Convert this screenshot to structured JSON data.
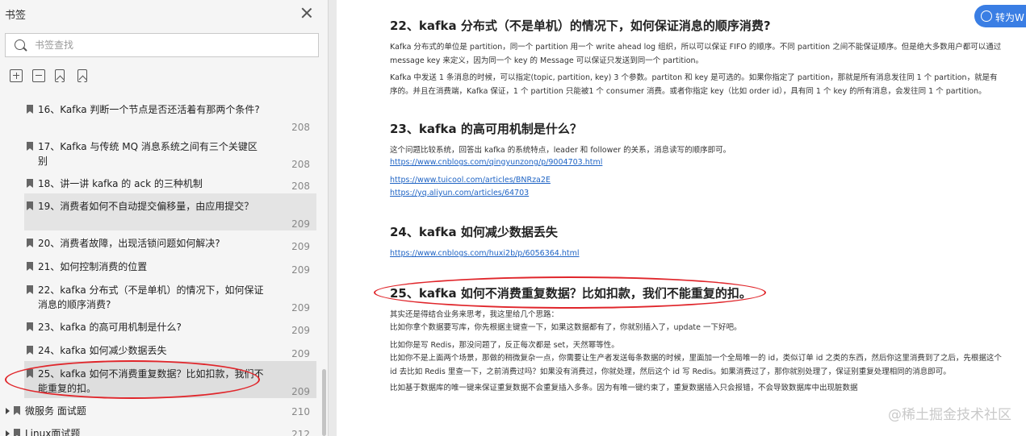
{
  "sidebar": {
    "title": "书签",
    "search_placeholder": "书签查找",
    "items": [
      {
        "text": "16、Kafka 判断一个节点是否还活着有那两个条件?",
        "page": "208"
      },
      {
        "text": "17、Kafka 与传统 MQ 消息系统之间有三个关键区别",
        "page": "208"
      },
      {
        "text": "18、讲一讲 kafka 的 ack 的三种机制",
        "page": "208"
      },
      {
        "text": "19、消费者如何不自动提交偏移量，由应用提交？",
        "page": "209"
      },
      {
        "text": "20、消费者故障，出现活锁问题如何解决?",
        "page": "209"
      },
      {
        "text": "21、如何控制消费的位置",
        "page": "209"
      },
      {
        "text": "22、kafka 分布式（不是单机）的情况下，如何保证消息的顺序消费?",
        "page": "209"
      },
      {
        "text": "23、kafka 的高可用机制是什么?",
        "page": "209"
      },
      {
        "text": "24、kafka 如何减少数据丢失",
        "page": "209"
      },
      {
        "text": "25、kafka 如何不消费重复数据？比如扣款，我们不能重复的扣。",
        "page": "209"
      }
    ],
    "groups": [
      {
        "text": "微服务 面试题",
        "page": "210"
      },
      {
        "text": "Linux面试题",
        "page": "212"
      }
    ]
  },
  "doc": {
    "convert_label": "转为W",
    "sections": [
      {
        "heading": "22、kafka 分布式（不是单机）的情况下，如何保证消息的顺序消费?",
        "paragraphs": [
          "Kafka 分布式的单位是 partition，同一个 partition 用一个 write ahead log 组织，所以可以保证 FIFO 的顺序。不同 partition 之间不能保证顺序。但是绝大多数用户都可以通过 message key 来定义，因为同一个 key 的 Message 可以保证只发送到同一个 partition。",
          "Kafka 中发送 1 条消息的时候，可以指定(topic, partition, key) 3 个参数。partiton 和 key 是可选的。如果你指定了 partition，那就是所有消息发往同 1 个 partition，就是有序的。并且在消费端，Kafka 保证，1 个 partition 只能被1 个 consumer 消费。或者你指定 key（比如 order id），具有同 1 个 key 的所有消息，会发往同 1 个 partition。"
        ]
      },
      {
        "heading": "23、kafka 的高可用机制是什么？",
        "paragraphs": [
          "这个问题比较系统，回答出 kafka 的系统特点，leader 和 follower 的关系，消息读写的顺序即可。"
        ],
        "links": [
          "https://www.cnblogs.com/qingyunzong/p/9004703.html",
          "https://www.tuicool.com/articles/BNRza2E",
          "https://yq.aliyun.com/articles/64703"
        ]
      },
      {
        "heading": "24、kafka 如何减少数据丢失",
        "links": [
          "https://www.cnblogs.com/huxi2b/p/6056364.html"
        ]
      },
      {
        "heading": "25、kafka 如何不消费重复数据？比如扣款，我们不能重复的扣。",
        "paragraphs": [
          "其实还是得结合业务来思考，我这里给几个思路：",
          "比如你拿个数据要写库，你先根据主键查一下，如果这数据都有了，你就别插入了，update 一下好吧。",
          "比如你是写 Redis，那没问题了，反正每次都是 set，天然幂等性。",
          "比如你不是上面两个场景，那做的稍微复杂一点，你需要让生产者发送每条数据的时候，里面加一个全局唯一的 id，类似订单 id 之类的东西，然后你这里消费到了之后，先根据这个 id 去比如 Redis 里查一下，之前消费过吗？如果没有消费过，你就处理，然后这个 id 写 Redis。如果消费过了，那你就别处理了，保证别重复处理相同的消息即可。",
          "比如基于数据库的唯一键来保证重复数据不会重复插入多条。因为有唯一键约束了，重复数据插入只会报错，不会导致数据库中出现脏数据"
        ]
      }
    ]
  },
  "watermark": "@稀土掘金技术社区",
  "colors": {
    "annotation": "#e0262b",
    "link": "#1e63c4",
    "accent": "#3a7ee4"
  }
}
